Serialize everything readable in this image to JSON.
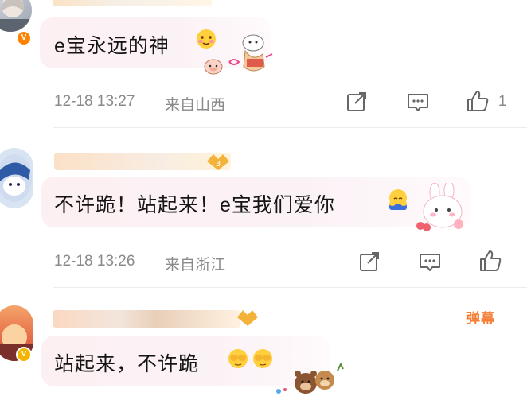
{
  "comments": [
    {
      "text": "e宝永远的神",
      "time": "12-18 13:27",
      "location": "来自山西",
      "like_count": "1"
    },
    {
      "text": "不许跪！站起来！e宝我们爱你",
      "time": "12-18 13:26",
      "location": "来自浙江",
      "like_count": ""
    },
    {
      "text": "站起来，不许跪"
    }
  ],
  "danmu_label": "弹幕",
  "colors": {
    "vip_badge": "#ff8200",
    "danmu": "#f47c33",
    "bubble": "#fdf0f2",
    "meta_text": "#8a8a8a"
  },
  "icons": [
    "share-icon",
    "comment-icon",
    "like-icon"
  ]
}
